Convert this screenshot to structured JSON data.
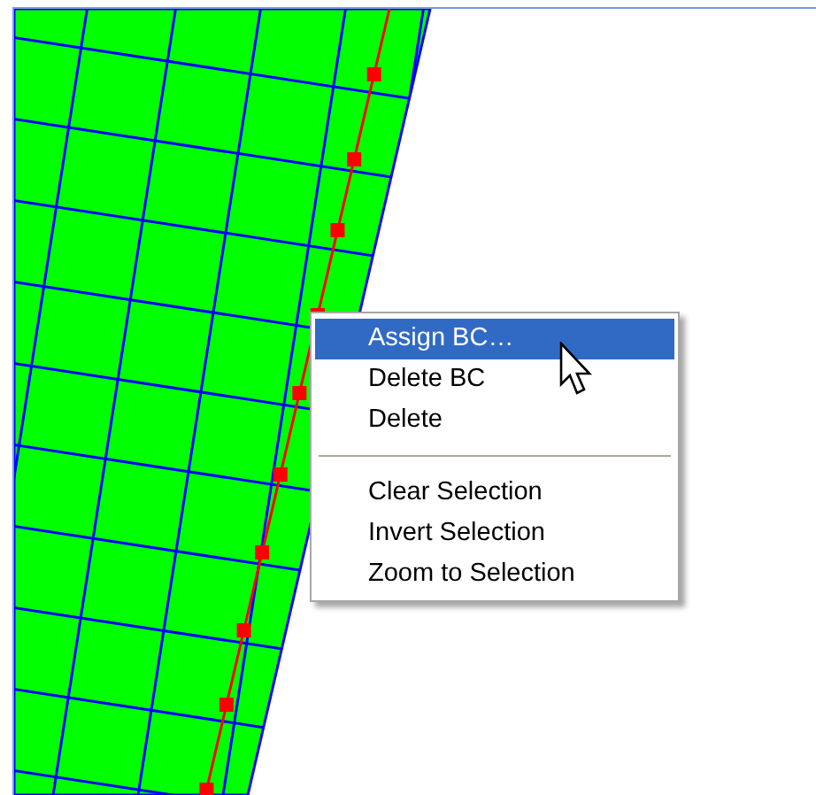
{
  "context_menu": {
    "items": [
      {
        "kind": "item",
        "label": "Assign BC…",
        "selected": true
      },
      {
        "kind": "item",
        "label": "Delete BC",
        "selected": false
      },
      {
        "kind": "item",
        "label": "Delete",
        "selected": false
      },
      {
        "kind": "separator"
      },
      {
        "kind": "item",
        "label": "Clear Selection",
        "selected": false
      },
      {
        "kind": "item",
        "label": "Invert Selection",
        "selected": false
      },
      {
        "kind": "item",
        "label": "Zoom to Selection",
        "selected": false
      }
    ]
  }
}
